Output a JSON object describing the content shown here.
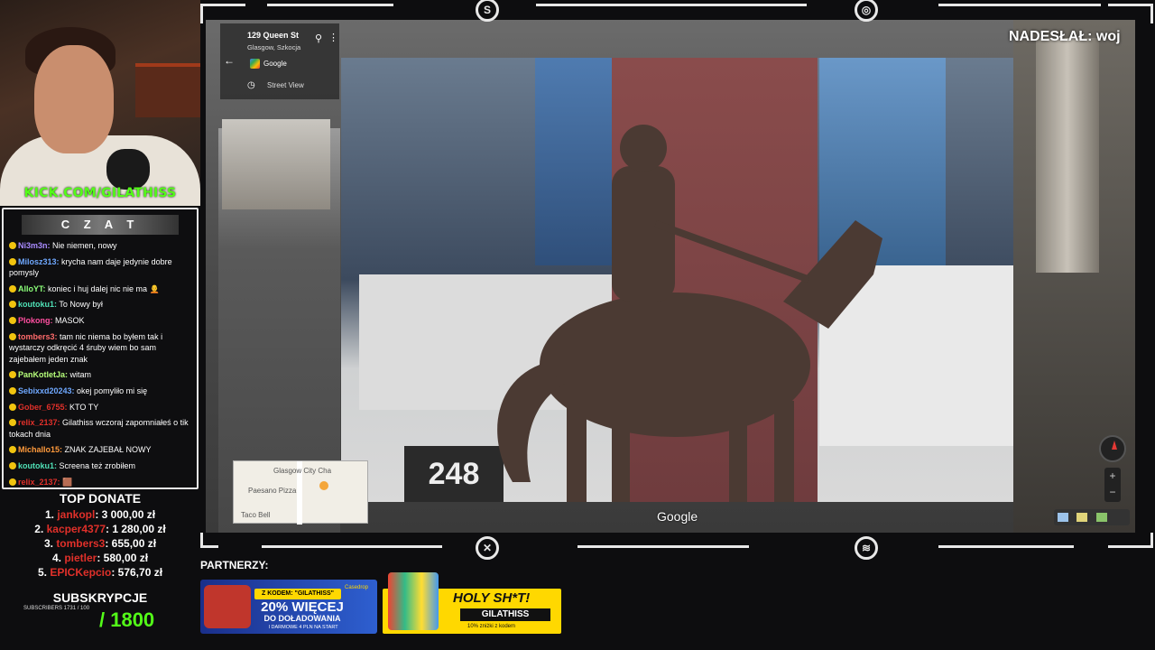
{
  "stream": {
    "kick_url": "KICK.COM/GILATHISS",
    "submitted_by": "NADESŁAŁ: woj",
    "partners_label": "PARTNERZY:"
  },
  "chat": {
    "title": "C Z A T",
    "messages": [
      {
        "name": "Ni3m3n:",
        "text": " Nie niemen, nowy",
        "color": "#a98bff"
      },
      {
        "name": "Milosz313:",
        "text": " krycha nam daje jedynie dobre pomysly",
        "color": "#6fa8ff"
      },
      {
        "name": "AlloYT:",
        "text": " koniec i huj dalej nic nie ma 🧑‍🦲",
        "color": "#8cff7a"
      },
      {
        "name": "koutoku1:",
        "text": " To Nowy był",
        "color": "#4fe0b6"
      },
      {
        "name": "Plokong:",
        "text": " MASOK",
        "color": "#ff4fa0"
      },
      {
        "name": "tombers3:",
        "text": " tam nic niema bo byłem tak i wystarczy odkręcić 4 śruby wiem bo sam zajebałem jeden znak",
        "color": "#ff6b6b"
      },
      {
        "name": "PanKotletJa:",
        "text": " witam",
        "color": "#b7ff7a"
      },
      {
        "name": "Sebixxd20243:",
        "text": " okej pomyliło mi się",
        "color": "#6fa8ff"
      },
      {
        "name": "Gober_6755:",
        "text": " KTO TY",
        "color": "#e0302a"
      },
      {
        "name": "relix_2137:",
        "text": " Gilathiss wczoraj zapomniałeś o tik tokach dnia",
        "color": "#e0302a"
      },
      {
        "name": "Michallo15:",
        "text": " ZNAK ZAJEBAŁ NOWY",
        "color": "#ff9a3c"
      },
      {
        "name": "koutoku1:",
        "text": " Screena też zrobiłem",
        "color": "#4fe0b6"
      },
      {
        "name": "relix_2137:",
        "text": " 🟫",
        "color": "#e0302a"
      }
    ]
  },
  "top_donate": {
    "title": "TOP DONATE",
    "entries": [
      {
        "rank": "1.",
        "name": "jankopl",
        "amount": ": 3 000,00 zł"
      },
      {
        "rank": "2.",
        "name": "kacper4377",
        "amount": ": 1 280,00 zł"
      },
      {
        "rank": "3.",
        "name": "tombers3",
        "amount": ": 655,00 zł"
      },
      {
        "rank": "4.",
        "name": "pietler",
        "amount": ": 580,00 zł"
      },
      {
        "rank": "5.",
        "name": "EPICKepcio",
        "amount": ": 576,70 zł"
      }
    ]
  },
  "subs": {
    "title": "SUBSKRYPCJE",
    "small": "SUBSCRIBERS 1731 / 100",
    "goal": "/ 1800"
  },
  "maps": {
    "address": "129 Queen St",
    "city": "Glasgow, Szkocja",
    "provider": "Google",
    "mode": "Street View",
    "watermark": "Google",
    "minimap": {
      "label1": "Glasgow City Cha",
      "label2": "Paesano Pizza",
      "label3": "Taco Bell"
    },
    "photo_sign": "248"
  },
  "ads": {
    "ad1": {
      "code": "Z KODEM: \"GILATHISS\"",
      "big": "20% WIĘCEJ",
      "line2": "DO DOŁADOWANIA",
      "line3": "I DARMOWE 4 PLN NA START",
      "brand": "Casedrop"
    },
    "ad2": {
      "headline": "HOLY SH*T!",
      "code": "GILATHISS",
      "small": "10% zniżki z kodem"
    }
  },
  "colors": {
    "kick_green": "#53fc18",
    "donate_red": "#e0302a"
  }
}
